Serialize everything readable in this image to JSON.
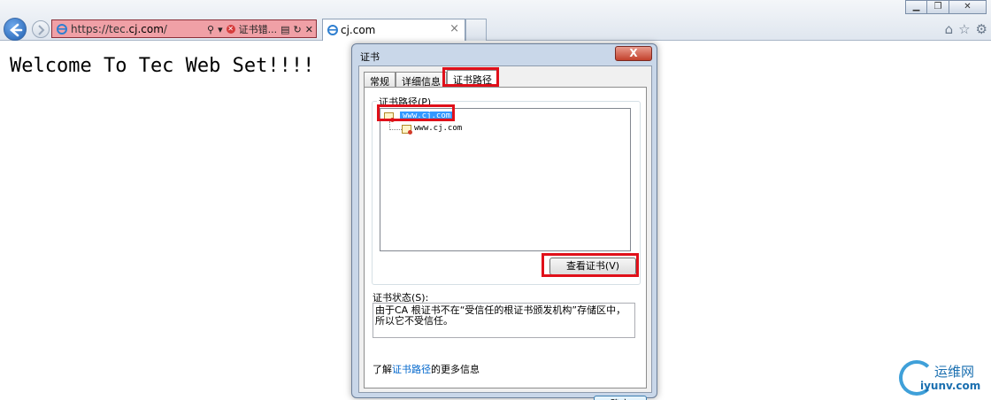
{
  "browser": {
    "url_prefix": "https://tec.",
    "url_domain": "cj.com",
    "url_suffix": "/",
    "cert_error_label": "证书错...",
    "tab_title": "cj.com",
    "tab_close": "×"
  },
  "page": {
    "welcome_text": "Welcome To Tec Web Set!!!!"
  },
  "dialog": {
    "title": "证书",
    "close_label": "X",
    "tabs": [
      "常规",
      "详细信息",
      "证书路径"
    ],
    "path_group_label": "证书路径(P)",
    "tree": [
      "www.cj.com",
      "www.cj.com"
    ],
    "view_cert_button": "查看证书(V)",
    "status_label": "证书状态(S):",
    "status_text": "由于CA 根证书不在“受信任的根证书颁发机构”存储区中，所以它不受信任。",
    "learn_prefix": "了解",
    "learn_link": "证书路径",
    "learn_suffix": "的更多信息",
    "ok_button": "确定"
  },
  "watermark": {
    "cn": "运维网",
    "en": "iyunv.com"
  },
  "colors": {
    "highlight": "#e0101a",
    "address_error": "#f0a0a6",
    "selection": "#3399ff"
  }
}
